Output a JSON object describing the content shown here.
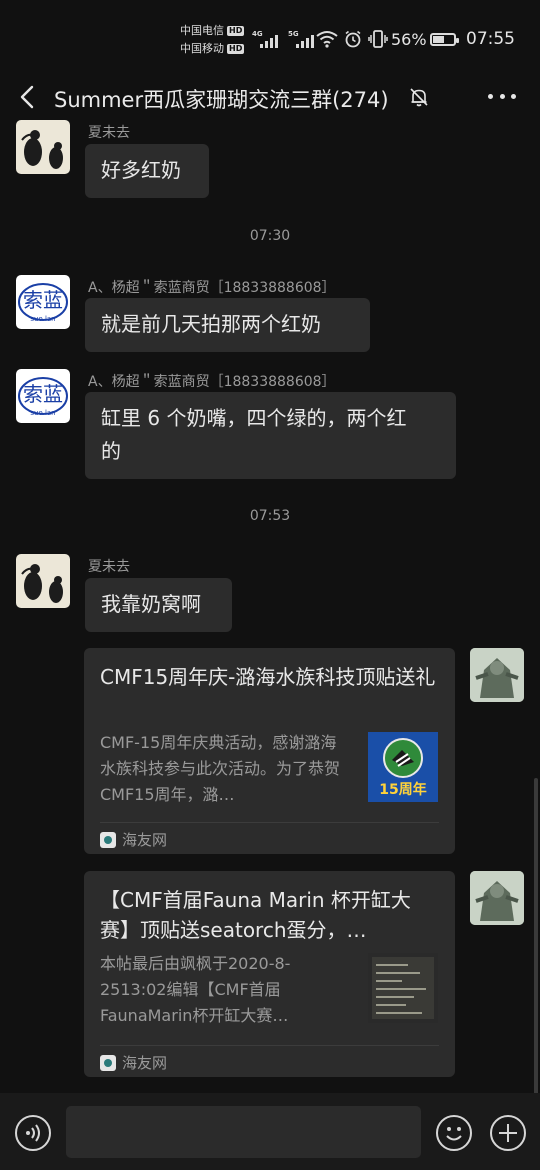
{
  "status": {
    "carrier1": "中国电信",
    "carrier2": "中国移动",
    "hd": "HD",
    "net1": "4G",
    "net2": "5G",
    "battery_pct": "56%",
    "battery_level": 0.56,
    "time": "07:55"
  },
  "header": {
    "title": "Summer西瓜家珊瑚交流三群(274)",
    "icons": [
      "back-icon",
      "mute-bell-icon",
      "more-icon"
    ]
  },
  "messages": {
    "m1_sender": "夏未去",
    "m1_text": "好多红奶",
    "t1": "07:30",
    "m2_sender": "A、杨超＂索蓝商贸［18833888608］",
    "m2_text": "就是前几天拍那两个红奶",
    "m3_sender": "A、杨超＂索蓝商贸［18833888608］",
    "m3_line1": "缸里 6 个奶嘴，四个绿的，两个红",
    "m3_line2": "的",
    "t2": "07:53",
    "m4_sender": "夏未去",
    "m4_text": "我靠奶窝啊"
  },
  "avatar_text": {
    "suolan_top": "索蓝",
    "suolan_bottom": "suo lan"
  },
  "cards": {
    "c1_title": "CMF15周年庆-潞海水族科技顶贴送礼",
    "c1_desc": "CMF-15周年庆典活动，感谢潞海水族科技参与此次活动。为了恭贺CMF15周年，潞…",
    "c1_thumb_text": "15周年",
    "c1_source": "海友网",
    "c2_title": "【CMF首届Fauna Marin 杯开缸大赛】顶贴送seatorch蛋分，…",
    "c2_desc": "本帖最后由飒枫于2020-8-2513:02编辑【CMF首届FaunaMarin杯开缸大赛…",
    "c2_source": "海友网"
  },
  "input": {
    "placeholder": ""
  },
  "colors": {
    "background": "#111111",
    "bubble": "#2c2c2c",
    "bottombar": "#1a1a1a",
    "muted_text": "#9a9a9a"
  }
}
